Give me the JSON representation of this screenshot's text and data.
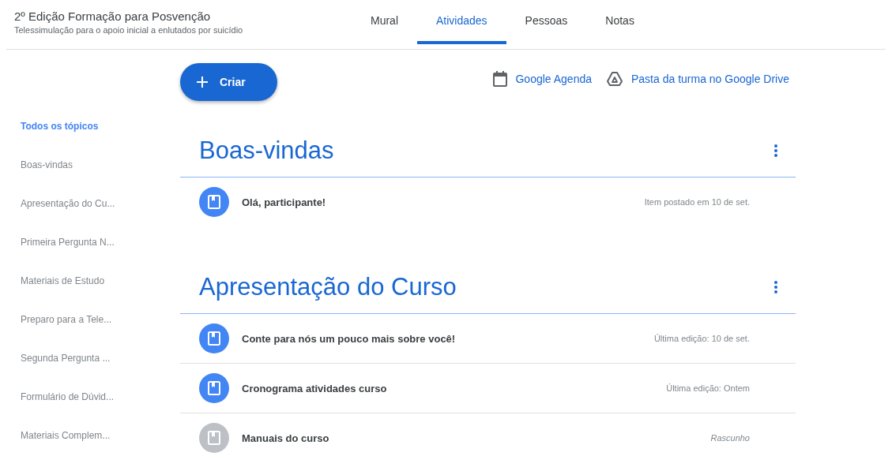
{
  "header": {
    "title": "2º Edição Formação para Posvenção",
    "subtitle": "Telessimulação para o apoio inicial a enlutados por suicídio"
  },
  "tabs": [
    {
      "label": "Mural",
      "selected": false
    },
    {
      "label": "Atividades",
      "selected": true
    },
    {
      "label": "Pessoas",
      "selected": false
    },
    {
      "label": "Notas",
      "selected": false
    }
  ],
  "create_button": {
    "label": "Criar"
  },
  "links": [
    {
      "kind": "calendar",
      "label": "Google Agenda"
    },
    {
      "kind": "drive",
      "label": "Pasta da turma no Google Drive"
    }
  ],
  "sidebar": {
    "items": [
      {
        "label": "Todos os tópicos",
        "selected": true
      },
      {
        "label": "Boas-vindas",
        "selected": false
      },
      {
        "label": "Apresentação do Cu...",
        "selected": false
      },
      {
        "label": "Primeira Pergunta N...",
        "selected": false
      },
      {
        "label": "Materiais de Estudo",
        "selected": false
      },
      {
        "label": "Preparo para a Tele...",
        "selected": false
      },
      {
        "label": "Segunda Pergunta ...",
        "selected": false
      },
      {
        "label": "Formulário de Dúvid...",
        "selected": false
      },
      {
        "label": "Materiais Complem...",
        "selected": false
      }
    ]
  },
  "topics": [
    {
      "title": "Boas-vindas",
      "items": [
        {
          "title": "Olá, participante!",
          "meta": "Item postado em 10 de set.",
          "draft": false
        }
      ]
    },
    {
      "title": "Apresentação do Curso",
      "items": [
        {
          "title": "Conte para nós um pouco mais sobre você!",
          "meta": "Última edição: 10 de set.",
          "draft": false
        },
        {
          "title": "Cronograma atividades curso",
          "meta": "Última edição: Ontem",
          "draft": false
        },
        {
          "title": "Manuais do curso",
          "meta": "Rascunho",
          "draft": true
        }
      ]
    }
  ]
}
